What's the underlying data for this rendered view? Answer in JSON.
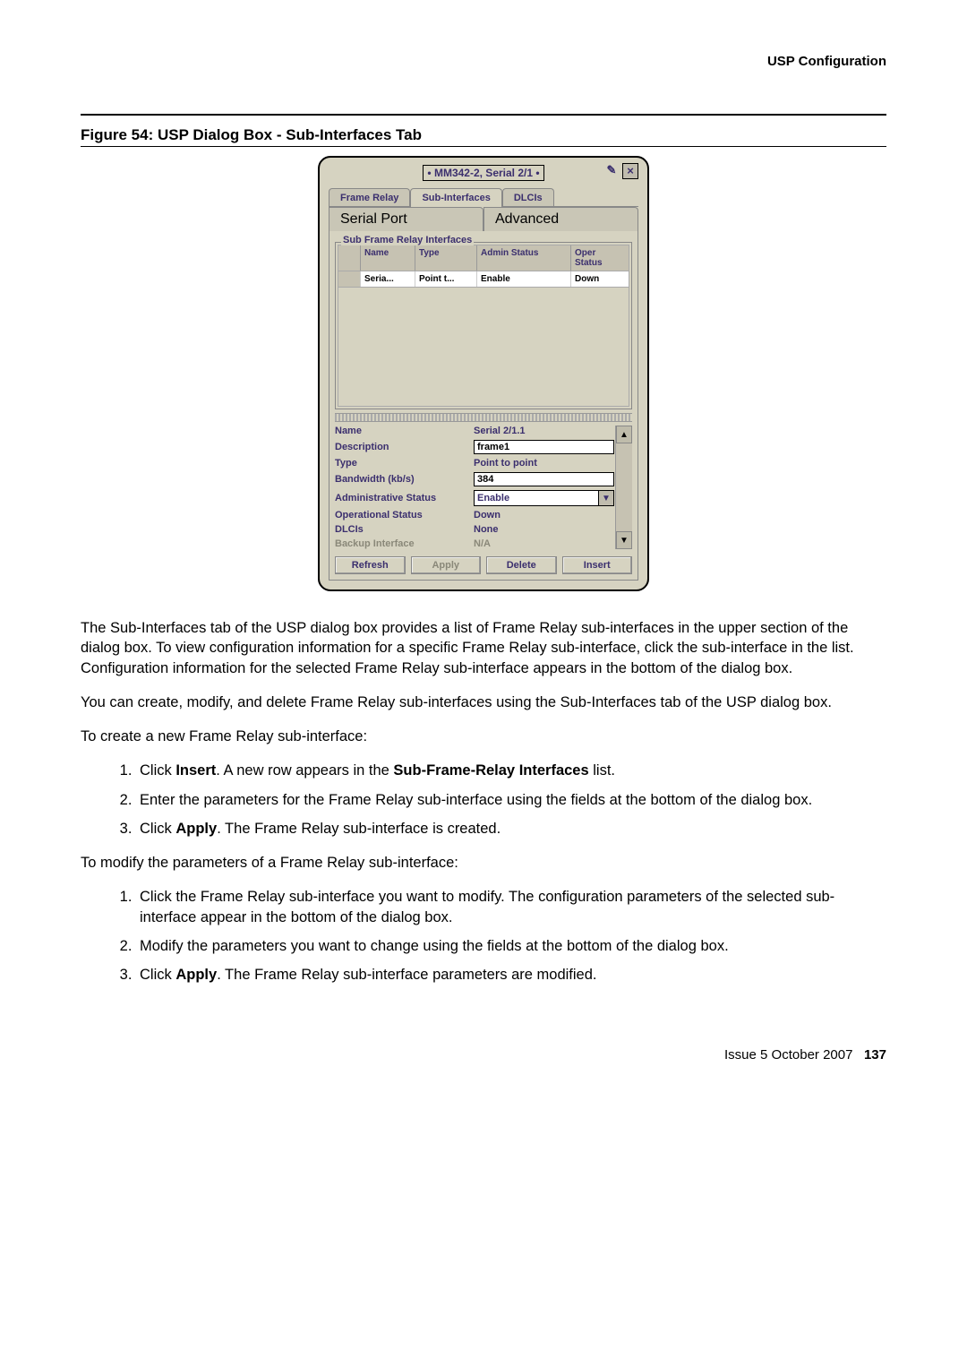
{
  "header": {
    "section": "USP Configuration"
  },
  "figure": {
    "caption": "Figure 54: USP Dialog Box - Sub-Interfaces Tab"
  },
  "dialog": {
    "title": "• MM342-2, Serial 2/1 •",
    "tabs": {
      "frame_relay": "Frame Relay",
      "sub_interfaces": "Sub-Interfaces",
      "dlcis": "DLCIs"
    },
    "subtabs": {
      "serial_port": "Serial Port",
      "advanced": "Advanced"
    },
    "group_label": "Sub Frame Relay Interfaces",
    "grid": {
      "headers": {
        "name": "Name",
        "type": "Type",
        "admin": "Admin Status",
        "oper": "Oper Status"
      },
      "row": {
        "name": "Seria...",
        "type": "Point t...",
        "admin": "Enable",
        "oper": "Down"
      }
    },
    "props": {
      "name_lbl": "Name",
      "name_val": "Serial 2/1.1",
      "desc_lbl": "Description",
      "desc_val": "frame1",
      "type_lbl": "Type",
      "type_val": "Point to point",
      "bw_lbl": "Bandwidth (kb/s)",
      "bw_val": "384",
      "admin_lbl": "Administrative Status",
      "admin_val": "Enable",
      "oper_lbl": "Operational Status",
      "oper_val": "Down",
      "dlcis_lbl": "DLCIs",
      "dlcis_val": "None",
      "backup_lbl": "Backup Interface",
      "backup_val": "N/A"
    },
    "buttons": {
      "refresh": "Refresh",
      "apply": "Apply",
      "delete": "Delete",
      "insert": "Insert"
    }
  },
  "body": {
    "p1": "The Sub-Interfaces tab of the USP dialog box provides a list of Frame Relay sub-interfaces in the upper section of the dialog box. To view configuration information for a specific Frame Relay sub-interface, click the sub-interface in the list. Configuration information for the selected Frame Relay sub-interface appears in the bottom of the dialog box.",
    "p2": "You can create, modify, and delete Frame Relay sub-interfaces using the Sub-Interfaces tab of the USP dialog box.",
    "p3": "To create a new Frame Relay sub-interface:",
    "create": {
      "s1a": "Click ",
      "s1b": "Insert",
      "s1c": ". A new row appears in the ",
      "s1d": "Sub-Frame-Relay Interfaces",
      "s1e": " list.",
      "s2": "Enter the parameters for the Frame Relay sub-interface using the fields at the bottom of the dialog box.",
      "s3a": "Click ",
      "s3b": "Apply",
      "s3c": ". The Frame Relay sub-interface is created."
    },
    "p4": "To modify the parameters of a Frame Relay sub-interface:",
    "modify": {
      "s1": "Click the Frame Relay sub-interface you want to modify. The configuration parameters of the selected sub-interface appear in the bottom of the dialog box.",
      "s2": "Modify the parameters you want to change using the fields at the bottom of the dialog box.",
      "s3a": "Click ",
      "s3b": "Apply",
      "s3c": ". The Frame Relay sub-interface parameters are modified."
    }
  },
  "footer": {
    "issue": "Issue 5  October 2007",
    "page": "137"
  }
}
